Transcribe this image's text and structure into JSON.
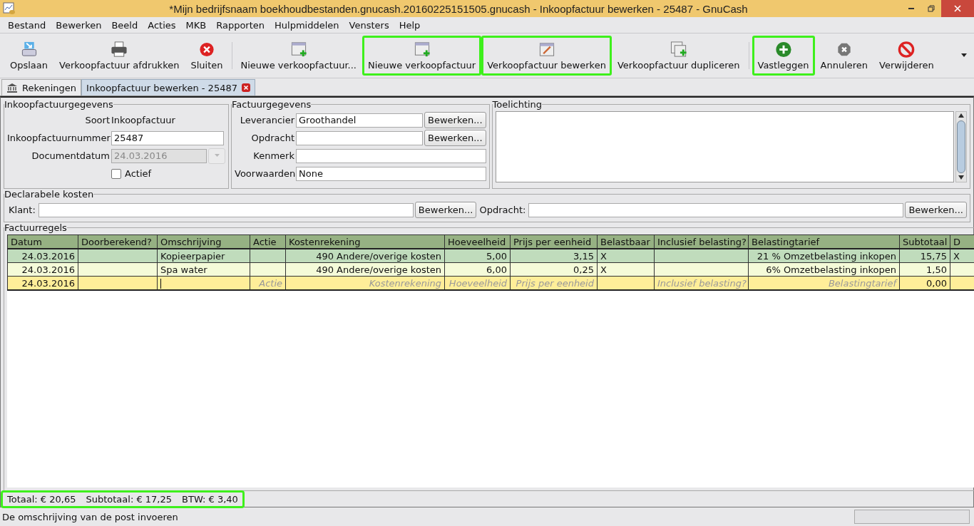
{
  "window": {
    "title": "*Mijn bedrijfsnaam boekhoudbestanden.gnucash.20160225151505.gnucash - Inkoopfactuur bewerken - 25487 - GnuCash"
  },
  "menu": [
    "Bestand",
    "Bewerken",
    "Beeld",
    "Acties",
    "MKB",
    "Rapporten",
    "Hulpmiddelen",
    "Vensters",
    "Help"
  ],
  "toolbar": [
    {
      "kind": "button",
      "label": "Opslaan",
      "highlighted": false
    },
    {
      "kind": "button",
      "label": "Verkoopfactuur afdrukken",
      "highlighted": false
    },
    {
      "kind": "button",
      "label": "Sluiten",
      "highlighted": false
    },
    {
      "kind": "separator"
    },
    {
      "kind": "button",
      "label": "Nieuwe verkoopfactuur...",
      "highlighted": false
    },
    {
      "kind": "button",
      "label": "Nieuwe verkoopfactuur",
      "highlighted": true
    },
    {
      "kind": "button",
      "label": "Verkoopfactuur bewerken",
      "highlighted": true
    },
    {
      "kind": "button",
      "label": "Verkoopfactuur dupliceren",
      "highlighted": false
    },
    {
      "kind": "separator"
    },
    {
      "kind": "button",
      "label": "Vastleggen",
      "highlighted": true
    },
    {
      "kind": "button",
      "label": "Annuleren",
      "highlighted": false
    },
    {
      "kind": "button",
      "label": "Verwijderen",
      "highlighted": false
    }
  ],
  "tabs": [
    {
      "label": "Rekeningen",
      "selected": false,
      "closable": false
    },
    {
      "label": "Inkoopfactuur bewerken - 25487",
      "selected": true,
      "closable": true
    }
  ],
  "invoice_info": {
    "title": "Inkoopfactuurgegevens",
    "type_label": "Soort",
    "type_value": "Inkoopfactuur",
    "number": {
      "label": "Inkoopfactuurnummer",
      "value": "25487"
    },
    "date": {
      "label": "Documentdatum",
      "value": "24.03.2016",
      "disabled": true
    },
    "active": {
      "label": "Actief",
      "checked": false
    }
  },
  "invoice_data": {
    "title": "Factuurgegevens",
    "fields": [
      {
        "label": "Leverancier",
        "value": "Groothandel",
        "button": "Bewerken..."
      },
      {
        "label": "Opdracht",
        "button": "Bewerken..."
      },
      {
        "label": "Kenmerk"
      },
      {
        "label": "Voorwaarden",
        "value": "None"
      }
    ]
  },
  "notes": {
    "title": "Toelichting"
  },
  "billable": {
    "title": "Declarabele kosten",
    "fields": [
      {
        "label": "Klant:",
        "button": "Bewerken..."
      },
      {
        "label": "Opdracht:",
        "button": "Bewerken..."
      }
    ]
  },
  "lines": {
    "title": "Factuurregels",
    "columns": [
      "Datum",
      "Doorberekend?",
      "Omschrijving",
      "Actie",
      "Kostenrekening",
      "Hoeveelheid",
      "Prijs per eenheid",
      "Belastbaar",
      "Inclusief belasting?",
      "Belastingtarief",
      "Subtotaal",
      "D"
    ],
    "rows": [
      {
        "kind": "entry",
        "selected": true,
        "cells": [
          {
            "text": "24.03.2016"
          },
          {},
          {
            "text": "Kopieerpapier"
          },
          {},
          {
            "text": "490 Andere/overige kosten"
          },
          {
            "text": "5,00"
          },
          {
            "text": "3,15"
          },
          {
            "text": "X"
          },
          {},
          {
            "text": "21 % Omzetbelasting inkopen"
          },
          {
            "text": "15,75"
          },
          {
            "text": "X"
          }
        ]
      },
      {
        "kind": "entry",
        "selected": false,
        "cells": [
          {
            "text": "24.03.2016"
          },
          {},
          {
            "text": "Spa water"
          },
          {},
          {
            "text": "490 Andere/overige kosten"
          },
          {
            "text": "6,00"
          },
          {
            "text": "0,25"
          },
          {
            "text": "X"
          },
          {},
          {
            "text": "6% Omzetbelasting inkopen"
          },
          {
            "text": "1,50"
          },
          {}
        ]
      },
      {
        "kind": "blank",
        "selected": false,
        "cells": [
          {
            "text": "24.03.2016"
          },
          {},
          {
            "cursor": true
          },
          {
            "placeholder": "Actie"
          },
          {
            "placeholder": "Kostenrekening"
          },
          {
            "placeholder": "Hoeveelheid"
          },
          {
            "placeholder": "Prijs per eenheid"
          },
          {},
          {
            "placeholder": "Inclusief belasting?"
          },
          {
            "placeholder": "Belastingtarief"
          },
          {
            "text": "0,00"
          },
          {}
        ]
      }
    ]
  },
  "totals": {
    "highlighted": true,
    "items": [
      "Totaal: € 20,65",
      "Subtotaal: € 17,25",
      "BTW: € 3,40"
    ]
  },
  "status_bar": {
    "text": "De omschrijving van de post invoeren",
    "progress": {
      "level": 0
    }
  }
}
